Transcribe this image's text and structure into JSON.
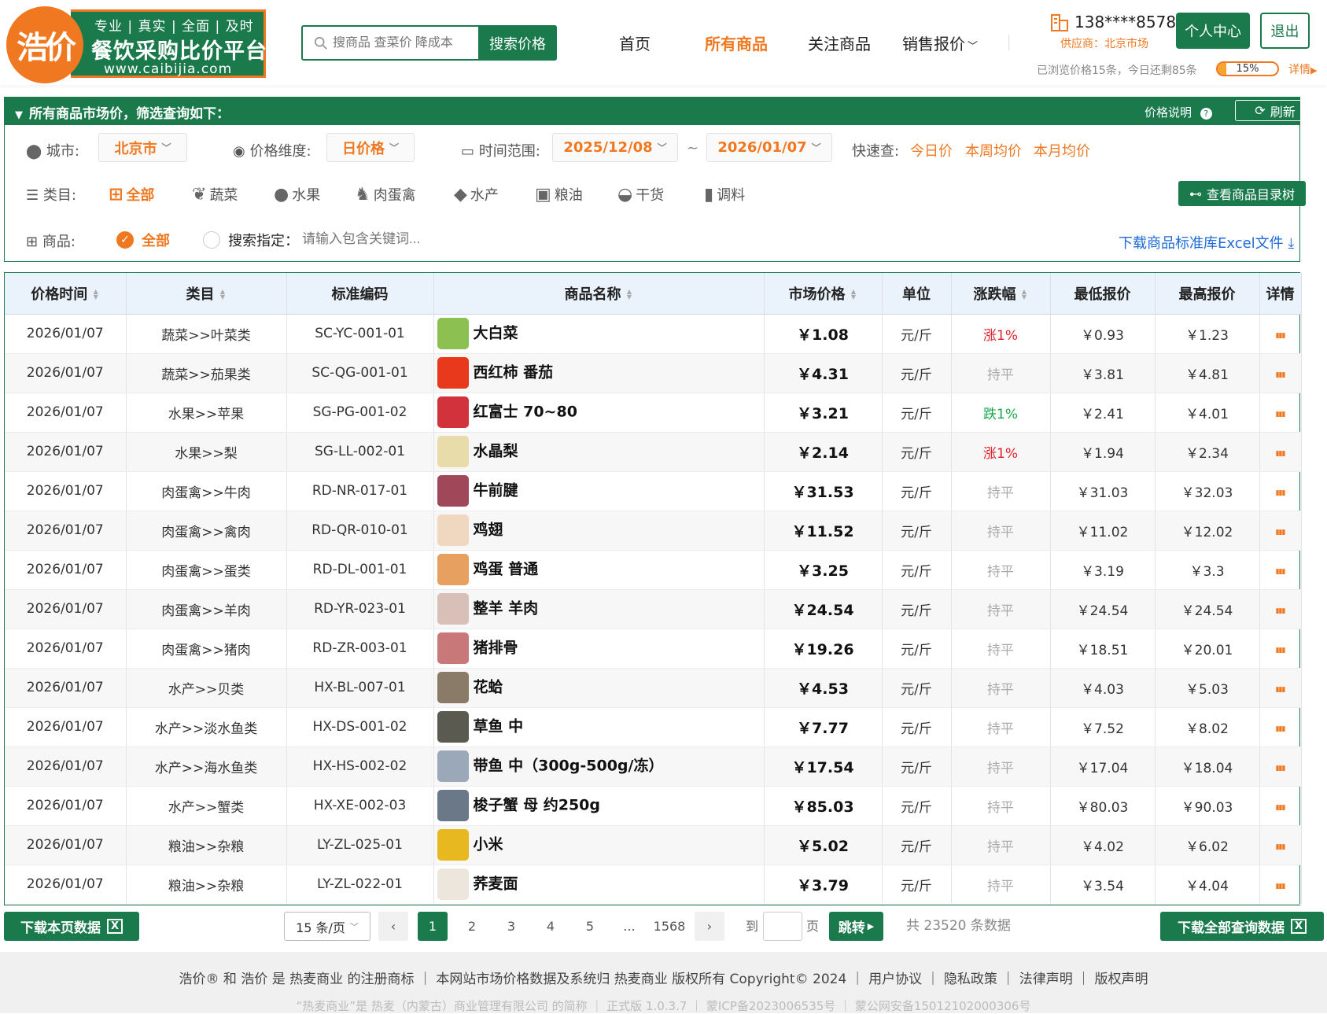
{
  "brand": {
    "logo_text": "浩价",
    "tagline": "专业 | 真实 | 全面 | 及时",
    "title": "餐饮采购比价平台",
    "url": "www.caibijia.com"
  },
  "search": {
    "placeholder": "搜商品 查菜价 降成本",
    "button": "搜索价格"
  },
  "nav": {
    "home": "首页",
    "all": "所有商品",
    "follow": "关注商品",
    "quote": "销售报价"
  },
  "user": {
    "phone": "138****8578",
    "supplier": "供应商：北京市场",
    "center_button": "个人中心",
    "logout_button": "退出",
    "browse_text": "已浏览价格15条，今日还剩85条",
    "progress": 0.15,
    "progress_label": "15%",
    "detail_link": "详情"
  },
  "filter": {
    "title": "所有商品市场价，筛选查询如下：",
    "price_note": "价格说明",
    "refresh": "刷新",
    "city_label": "城市:",
    "city": "北京市",
    "dimension_label": "价格维度:",
    "dimension": "日价格",
    "range_label": "时间范围:",
    "start_date": "2025/12/08",
    "tilde": "~",
    "end_date": "2026/01/07",
    "quick_label": "快速查:",
    "quick": [
      "今日价",
      "本周均价",
      "本月均价"
    ],
    "category_label": "类目:",
    "categories": [
      {
        "label": "全部",
        "icon": "grid-icon"
      },
      {
        "label": "蔬菜",
        "icon": "vegetable-icon"
      },
      {
        "label": "水果",
        "icon": "apple-icon"
      },
      {
        "label": "肉蛋禽",
        "icon": "cow-icon"
      },
      {
        "label": "水产",
        "icon": "fish-icon"
      },
      {
        "label": "粮油",
        "icon": "oil-icon"
      },
      {
        "label": "干货",
        "icon": "acorn-icon"
      },
      {
        "label": "调料",
        "icon": "bottle-icon"
      }
    ],
    "catalog_button": "查看商品目录树",
    "goods_label": "商品:",
    "goods_all": "全部",
    "keyword_label": "搜索指定：",
    "keyword_placeholder": "请输入包含关键词...",
    "download_std": "下载商品标准库Excel文件"
  },
  "table": {
    "headers": [
      "价格时间",
      "类目",
      "标准编码",
      "商品名称",
      "市场价格",
      "单位",
      "涨跌幅",
      "最低报价",
      "最高报价",
      "详情"
    ],
    "rows": [
      {
        "date": "2026/01/07",
        "category": "蔬菜>>叶菜类",
        "code": "SC-YC-001-01",
        "name": "大白菜",
        "price": "￥1.08",
        "unit": "元/斤",
        "change": "涨1%",
        "trend": "up",
        "low": "￥0.93",
        "high": "￥1.23",
        "color": "#8cc152"
      },
      {
        "date": "2026/01/07",
        "category": "蔬菜>>茄果类",
        "code": "SC-QG-001-01",
        "name": "西红柿 番茄",
        "price": "￥4.31",
        "unit": "元/斤",
        "change": "持平",
        "trend": "flat",
        "low": "￥3.81",
        "high": "￥4.81",
        "color": "#e8391d"
      },
      {
        "date": "2026/01/07",
        "category": "水果>>苹果",
        "code": "SG-PG-001-02",
        "name": "红富士 70~80",
        "price": "￥3.21",
        "unit": "元/斤",
        "change": "跌1%",
        "trend": "down",
        "low": "￥2.41",
        "high": "￥4.01",
        "color": "#d2323c"
      },
      {
        "date": "2026/01/07",
        "category": "水果>>梨",
        "code": "SG-LL-002-01",
        "name": "水晶梨",
        "price": "￥2.14",
        "unit": "元/斤",
        "change": "涨1%",
        "trend": "up",
        "low": "￥1.94",
        "high": "￥2.34",
        "color": "#e8dcaa"
      },
      {
        "date": "2026/01/07",
        "category": "肉蛋禽>>牛肉",
        "code": "RD-NR-017-01",
        "name": "牛前腱",
        "price": "￥31.53",
        "unit": "元/斤",
        "change": "持平",
        "trend": "flat",
        "low": "￥31.03",
        "high": "￥32.03",
        "color": "#a0485a"
      },
      {
        "date": "2026/01/07",
        "category": "肉蛋禽>>禽肉",
        "code": "RD-QR-010-01",
        "name": "鸡翅",
        "price": "￥11.52",
        "unit": "元/斤",
        "change": "持平",
        "trend": "flat",
        "low": "￥11.02",
        "high": "￥12.02",
        "color": "#f0d8c0"
      },
      {
        "date": "2026/01/07",
        "category": "肉蛋禽>>蛋类",
        "code": "RD-DL-001-01",
        "name": "鸡蛋 普通",
        "price": "￥3.25",
        "unit": "元/斤",
        "change": "持平",
        "trend": "flat",
        "low": "￥3.19",
        "high": "￥3.3",
        "color": "#e8a060"
      },
      {
        "date": "2026/01/07",
        "category": "肉蛋禽>>羊肉",
        "code": "RD-YR-023-01",
        "name": "整羊 羊肉",
        "price": "￥24.54",
        "unit": "元/斤",
        "change": "持平",
        "trend": "flat",
        "low": "￥24.54",
        "high": "￥24.54",
        "color": "#d8c0b8"
      },
      {
        "date": "2026/01/07",
        "category": "肉蛋禽>>猪肉",
        "code": "RD-ZR-003-01",
        "name": "猪排骨",
        "price": "￥19.26",
        "unit": "元/斤",
        "change": "持平",
        "trend": "flat",
        "low": "￥18.51",
        "high": "￥20.01",
        "color": "#c87878"
      },
      {
        "date": "2026/01/07",
        "category": "水产>>贝类",
        "code": "HX-BL-007-01",
        "name": "花蛤",
        "price": "￥4.53",
        "unit": "元/斤",
        "change": "持平",
        "trend": "flat",
        "low": "￥4.03",
        "high": "￥5.03",
        "color": "#8a7a68"
      },
      {
        "date": "2026/01/07",
        "category": "水产>>淡水鱼类",
        "code": "HX-DS-001-02",
        "name": "草鱼 中",
        "price": "￥7.77",
        "unit": "元/斤",
        "change": "持平",
        "trend": "flat",
        "low": "￥7.52",
        "high": "￥8.02",
        "color": "#5a5a50"
      },
      {
        "date": "2026/01/07",
        "category": "水产>>海水鱼类",
        "code": "HX-HS-002-02",
        "name": "带鱼 中（300g-500g/冻）",
        "price": "￥17.54",
        "unit": "元/斤",
        "change": "持平",
        "trend": "flat",
        "low": "￥17.04",
        "high": "￥18.04",
        "color": "#9aa8b8"
      },
      {
        "date": "2026/01/07",
        "category": "水产>>蟹类",
        "code": "HX-XE-002-03",
        "name": "梭子蟹 母 约250g",
        "price": "￥85.03",
        "unit": "元/斤",
        "change": "持平",
        "trend": "flat",
        "low": "￥80.03",
        "high": "￥90.03",
        "color": "#6a7888"
      },
      {
        "date": "2026/01/07",
        "category": "粮油>>杂粮",
        "code": "LY-ZL-025-01",
        "name": "小米",
        "price": "￥5.02",
        "unit": "元/斤",
        "change": "持平",
        "trend": "flat",
        "low": "￥4.02",
        "high": "￥6.02",
        "color": "#e8b820"
      },
      {
        "date": "2026/01/07",
        "category": "粮油>>杂粮",
        "code": "LY-ZL-022-01",
        "name": "荞麦面",
        "price": "￥3.79",
        "unit": "元/斤",
        "change": "持平",
        "trend": "flat",
        "low": "￥3.54",
        "high": "￥4.04",
        "color": "#ece6dc"
      }
    ]
  },
  "pager": {
    "download_page": "下载本页数据",
    "page_size": "15 条/页",
    "pages": [
      "1",
      "2",
      "3",
      "4",
      "5",
      "...",
      "1568"
    ],
    "goto_label": "到",
    "page_unit": "页",
    "jump_button": "跳转",
    "total": "共 23520 条数据",
    "download_all": "下载全部查询数据"
  },
  "footer": {
    "line1": "浩价® 和 浩价 是 热麦商业 的注册商标 ｜ 本网站市场价格数据及系统归 热麦商业 版权所有 Copyright© 2024 ｜ 用户协议 ｜ 隐私政策 ｜ 法律声明 ｜ 版权声明",
    "line2": "“热麦商业”是 热麦（内蒙古）商业管理有限公司 的简称 ｜ 正式版 1.0.3.7 ｜ 蒙ICP备2023006535号 ｜ 蒙公网安备15012102000306号"
  },
  "colors": {
    "primary": "#1a7a4c",
    "accent": "#f07820",
    "up": "#e3202a",
    "down": "#19a84a",
    "link": "#1e6ad8"
  }
}
